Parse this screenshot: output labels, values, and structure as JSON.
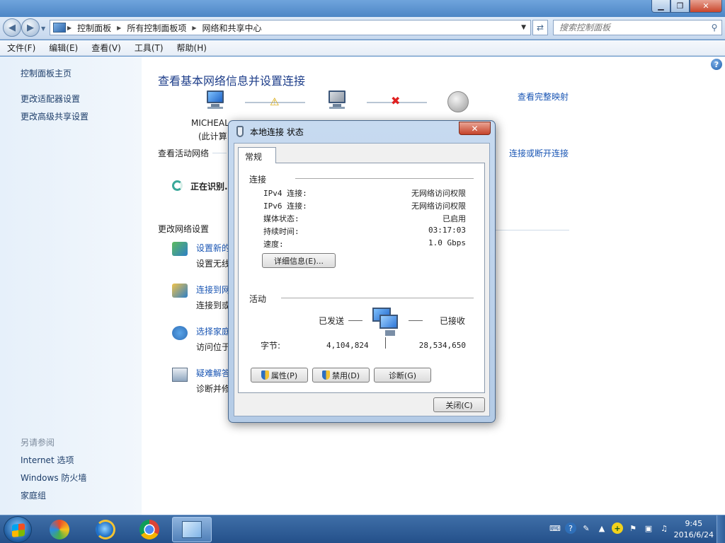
{
  "window": {
    "controls": {
      "minimize": "▁",
      "maximize": "❐",
      "close": "✕"
    }
  },
  "address_bar": {
    "crumbs": [
      "控制面板",
      "所有控制面板项",
      "网络和共享中心"
    ]
  },
  "search": {
    "placeholder": "搜索控制面板"
  },
  "menu": [
    "文件(F)",
    "编辑(E)",
    "查看(V)",
    "工具(T)",
    "帮助(H)"
  ],
  "sidebar": {
    "links": [
      "控制面板主页",
      "更改适配器设置",
      "更改高级共享设置"
    ],
    "see_also_title": "另请参阅",
    "see_also": [
      "Internet 选项",
      "Windows 防火墙",
      "家庭组"
    ]
  },
  "main": {
    "title": "查看基本网络信息并设置连接",
    "map_link": "查看完整映射",
    "computer_name": "MICHEAL",
    "computer_sub": "(此计算",
    "active_networks_label": "查看活动网络",
    "identifying": "正在识别...",
    "connect_link": "连接或断开连接",
    "change_settings_label": "更改网络设置",
    "tasks": [
      {
        "title": "设置新的",
        "desc": "设置无线",
        "icon": "new-connection-icon"
      },
      {
        "title": "连接到网",
        "desc": "连接到或",
        "icon": "connect-network-icon"
      },
      {
        "title": "选择家庭",
        "desc": "访问位于",
        "icon": "homegroup-icon"
      },
      {
        "title": "疑难解答",
        "desc": "诊断并修",
        "icon": "troubleshoot-icon"
      }
    ]
  },
  "dialog": {
    "title": "本地连接 状态",
    "close": "✕",
    "tab": "常规",
    "connection_group": "连接",
    "rows": [
      {
        "k": "IPv4 连接:",
        "v": "无网络访问权限"
      },
      {
        "k": "IPv6 连接:",
        "v": "无网络访问权限"
      },
      {
        "k": "媒体状态:",
        "v": "已启用"
      },
      {
        "k": "持续时间:",
        "v": "03:17:03"
      },
      {
        "k": "速度:",
        "v": "1.0 Gbps"
      }
    ],
    "details_button": "详细信息(E)...",
    "activity_group": "活动",
    "sent_label": "已发送",
    "received_label": "已接收",
    "bytes_label": "字节:",
    "bytes_sent": "4,104,824",
    "bytes_received": "28,534,650",
    "properties_button": "属性(P)",
    "disable_button": "禁用(D)",
    "diagnose_button": "诊断(G)",
    "close_button": "关闭(C)"
  },
  "taskbar": {
    "clock_time": "9:45",
    "clock_date": "2016/6/24"
  },
  "colors": {
    "link": "#1a56b4",
    "title": "#1e3e8a",
    "warning": "#f2c233",
    "error": "#e02020"
  }
}
